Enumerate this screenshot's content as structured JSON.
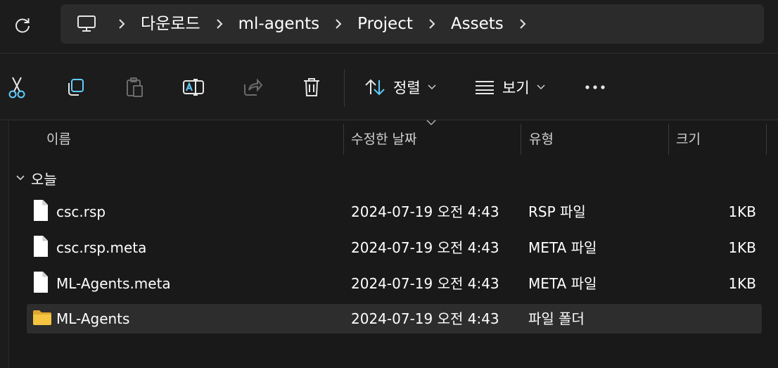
{
  "address_bar": {
    "crumbs": [
      "다운로드",
      "ml-agents",
      "Project",
      "Assets"
    ]
  },
  "toolbar": {
    "sort_label": "정렬",
    "view_label": "보기"
  },
  "columns": {
    "name": "이름",
    "date": "수정한 날짜",
    "type": "유형",
    "size": "크기"
  },
  "group": {
    "label": "오늘"
  },
  "files": [
    {
      "name": "csc.rsp",
      "date": "2024-07-19 오전 4:43",
      "type": "RSP 파일",
      "size": "1KB",
      "kind": "file"
    },
    {
      "name": "csc.rsp.meta",
      "date": "2024-07-19 오전 4:43",
      "type": "META 파일",
      "size": "1KB",
      "kind": "file"
    },
    {
      "name": "ML-Agents.meta",
      "date": "2024-07-19 오전 4:43",
      "type": "META 파일",
      "size": "1KB",
      "kind": "file"
    },
    {
      "name": "ML-Agents",
      "date": "2024-07-19 오전 4:43",
      "type": "파일 폴더",
      "size": "",
      "kind": "folder",
      "selected": true
    }
  ],
  "colors": {
    "accent": "#60cdff",
    "folder": "#f5c542",
    "background": "#191919"
  }
}
